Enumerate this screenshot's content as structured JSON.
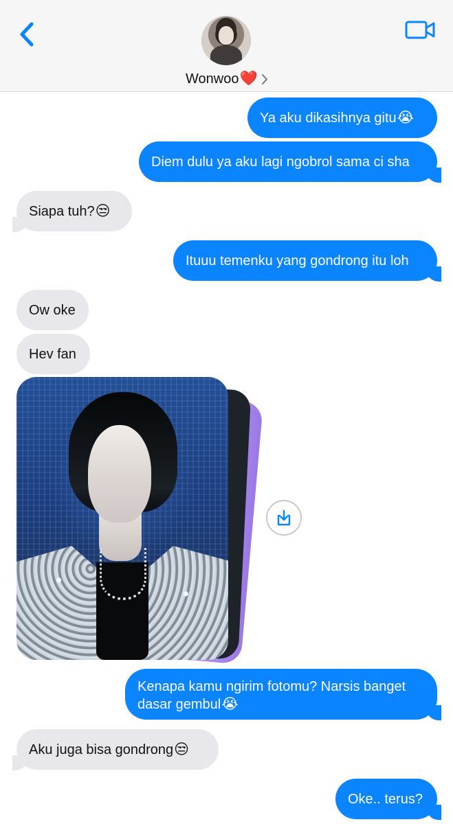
{
  "header": {
    "contact_name": "Wonwoo",
    "heart_emoji": "❤️",
    "back_icon": "chevron-left-icon",
    "video_icon": "video-camera-icon",
    "avatar_icon": "contact-avatar"
  },
  "messages": [
    {
      "direction": "outgoing",
      "text": "Ya aku dikasihnya gitu",
      "emoji": "😭"
    },
    {
      "direction": "outgoing",
      "text": "Diem dulu ya aku lagi ngobrol sama ci sha",
      "emoji": ""
    },
    {
      "direction": "incoming",
      "text": "Siapa tuh?",
      "emoji": "😒"
    },
    {
      "direction": "outgoing",
      "text": "Ituuu temenku yang gondrong itu loh",
      "emoji": ""
    },
    {
      "direction": "incoming",
      "text": "Ow oke",
      "emoji": ""
    },
    {
      "direction": "incoming",
      "text": "Hev fan",
      "emoji": ""
    },
    {
      "direction": "incoming",
      "type": "photo-stack",
      "photo_count": 3
    },
    {
      "direction": "outgoing",
      "text_line1": "Kenapa kamu ngirim fotomu? Narsis banget",
      "text_line2": "dasar gembul",
      "emoji": "😭"
    },
    {
      "direction": "incoming",
      "text": "Aku juga bisa gondrong",
      "emoji": "😒"
    },
    {
      "direction": "outgoing",
      "text": "Oke.. terus?",
      "emoji": ""
    }
  ],
  "colors": {
    "outgoing_bubble": "#0A84FF",
    "incoming_bubble": "#E8E8EC",
    "accent": "#0A84FF"
  }
}
